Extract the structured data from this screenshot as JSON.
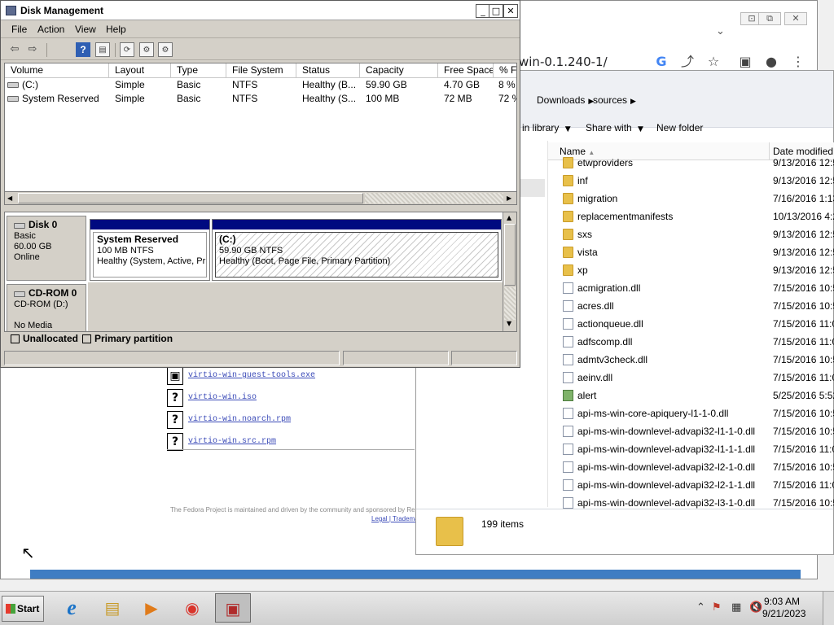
{
  "browser": {
    "url_fragment": "win-0.1.240-1/",
    "window_controls": [
      "⊡",
      "⧉",
      "✕"
    ],
    "chevron": "⌄",
    "toolbar_icons": [
      "G",
      "⤴",
      "☆",
      "▣",
      "●",
      "⋮"
    ],
    "files": [
      {
        "icon": "▣",
        "name": "virtio-win-guest-tools.exe"
      },
      {
        "icon": "?",
        "name": "virtio-win.iso"
      },
      {
        "icon": "?",
        "name": "virtio-win.noarch.rpm"
      },
      {
        "icon": "?",
        "name": "virtio-win.src.rpm"
      }
    ],
    "footer_text": "The Fedora Project is maintained and driven by the community and sponsored by Red Hat.",
    "footer_links": [
      "Legal",
      "|",
      "Trademark"
    ]
  },
  "explorer": {
    "breadcrumbs": [
      "Downloads",
      "sources"
    ],
    "toolbar": [
      "in library",
      "Share with",
      "New folder"
    ],
    "columns": [
      "Name",
      "Date modified"
    ],
    "files": [
      {
        "type": "folder",
        "name": "etwproviders",
        "date": "9/13/2016 12:5"
      },
      {
        "type": "folder",
        "name": "inf",
        "date": "9/13/2016 12:5"
      },
      {
        "type": "folder",
        "name": "migration",
        "date": "7/16/2016 1:13"
      },
      {
        "type": "folder",
        "name": "replacementmanifests",
        "date": "10/13/2016 4:2"
      },
      {
        "type": "folder",
        "name": "sxs",
        "date": "9/13/2016 12:5"
      },
      {
        "type": "folder",
        "name": "vista",
        "date": "9/13/2016 12:5"
      },
      {
        "type": "folder",
        "name": "xp",
        "date": "9/13/2016 12:5"
      },
      {
        "type": "dll",
        "name": "acmigration.dll",
        "date": "7/15/2016 10:5"
      },
      {
        "type": "dll",
        "name": "acres.dll",
        "date": "7/15/2016 10:5"
      },
      {
        "type": "dll",
        "name": "actionqueue.dll",
        "date": "7/15/2016 11:0"
      },
      {
        "type": "dll",
        "name": "adfscomp.dll",
        "date": "7/15/2016 11:0"
      },
      {
        "type": "dll",
        "name": "admtv3check.dll",
        "date": "7/15/2016 10:5"
      },
      {
        "type": "dll",
        "name": "aeinv.dll",
        "date": "7/15/2016 11:0"
      },
      {
        "type": "image",
        "name": "alert",
        "date": "5/25/2016 5:52"
      },
      {
        "type": "dll",
        "name": "api-ms-win-core-apiquery-l1-1-0.dll",
        "date": "7/15/2016 10:5"
      },
      {
        "type": "dll",
        "name": "api-ms-win-downlevel-advapi32-l1-1-0.dll",
        "date": "7/15/2016 10:5"
      },
      {
        "type": "dll",
        "name": "api-ms-win-downlevel-advapi32-l1-1-1.dll",
        "date": "7/15/2016 11:0"
      },
      {
        "type": "dll",
        "name": "api-ms-win-downlevel-advapi32-l2-1-0.dll",
        "date": "7/15/2016 10:5"
      },
      {
        "type": "dll",
        "name": "api-ms-win-downlevel-advapi32-l2-1-1.dll",
        "date": "7/15/2016 11:0"
      },
      {
        "type": "dll",
        "name": "api-ms-win-downlevel-advapi32-l3-1-0.dll",
        "date": "7/15/2016 10:5"
      }
    ],
    "item_count": "199 items"
  },
  "disk_mgmt": {
    "title": "Disk Management",
    "window_buttons": [
      "_",
      "□",
      "✕"
    ],
    "menu": [
      "File",
      "Action",
      "View",
      "Help"
    ],
    "toolbar_icons": [
      "⇦",
      "⇨",
      "?",
      "▤",
      "⟳",
      "⚙",
      "⚙"
    ],
    "columns": [
      "Volume",
      "Layout",
      "Type",
      "File System",
      "Status",
      "Capacity",
      "Free Space",
      "% Fr"
    ],
    "volumes": [
      [
        "(C:)",
        "Simple",
        "Basic",
        "NTFS",
        "Healthy (B...",
        "59.90 GB",
        "4.70 GB",
        "8 %"
      ],
      [
        "System Reserved",
        "Simple",
        "Basic",
        "NTFS",
        "Healthy (S...",
        "100 MB",
        "72 MB",
        "72 %"
      ]
    ],
    "disk0": {
      "name": "Disk 0",
      "type": "Basic",
      "size": "60.00 GB",
      "state": "Online",
      "partitions": [
        {
          "name": "System Reserved",
          "size": "100 MB NTFS",
          "status": "Healthy (System, Active, Primary Partition)"
        },
        {
          "name": "(C:)",
          "size": "59.90 GB NTFS",
          "status": "Healthy (Boot, Page File, Primary Partition)"
        }
      ]
    },
    "cdrom": {
      "name": "CD-ROM 0",
      "drive": "CD-ROM (D:)",
      "state": "No Media"
    },
    "legend": [
      {
        "label": "Unallocated",
        "color": "#000000"
      },
      {
        "label": "Primary partition",
        "color": "#000a80"
      }
    ]
  },
  "taskbar": {
    "start": "Start",
    "apps": [
      "e",
      "▤",
      "▶",
      "◉",
      "▣"
    ],
    "tray_icons": [
      "⌃",
      "⚑",
      "▦",
      "🔇"
    ],
    "time": "9:03 AM",
    "date": "9/21/2023"
  },
  "cursor": "↖"
}
